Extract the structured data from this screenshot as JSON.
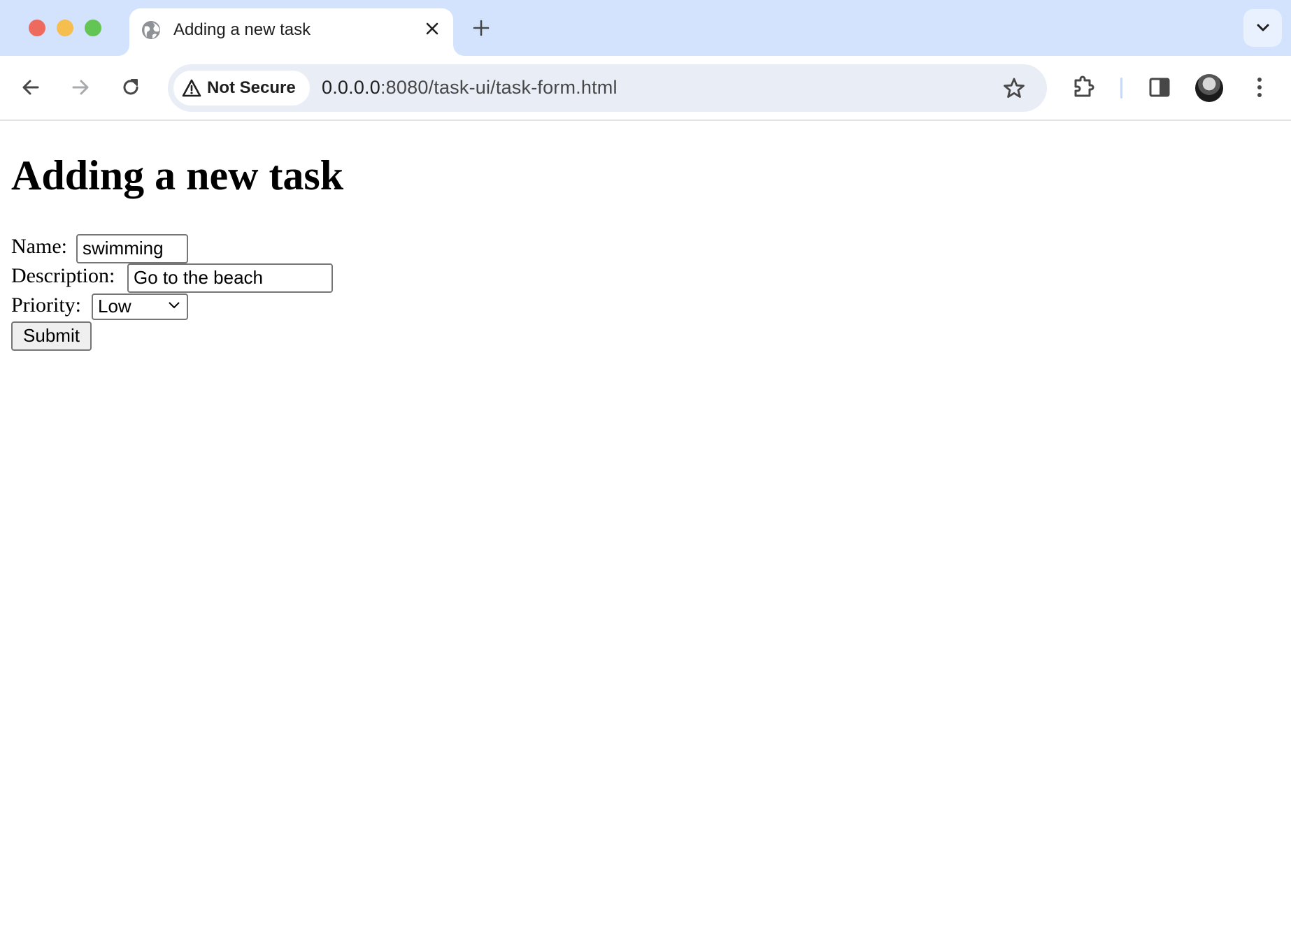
{
  "browser": {
    "traffic_lights": {
      "close": "#ee6a5f",
      "minimize": "#f5be4f",
      "zoom": "#62c554"
    },
    "tab": {
      "title": "Adding a new task",
      "icon": "globe-icon"
    },
    "new_tab_label": "+",
    "omnibox": {
      "security_label": "Not Secure",
      "url_host": "0.0.0.0",
      "url_rest": ":8080/task-ui/task-form.html"
    },
    "colors": {
      "tabstrip": "#d3e3fd",
      "omnibox": "#e9edf6",
      "icon": "#474747"
    }
  },
  "page": {
    "heading": "Adding a new task",
    "form": {
      "name_label": "Name:",
      "name_value": "swimming",
      "description_label": "Description:",
      "description_value": "Go to the beach",
      "priority_label": "Priority:",
      "priority_selected": "Low",
      "submit_label": "Submit"
    }
  }
}
